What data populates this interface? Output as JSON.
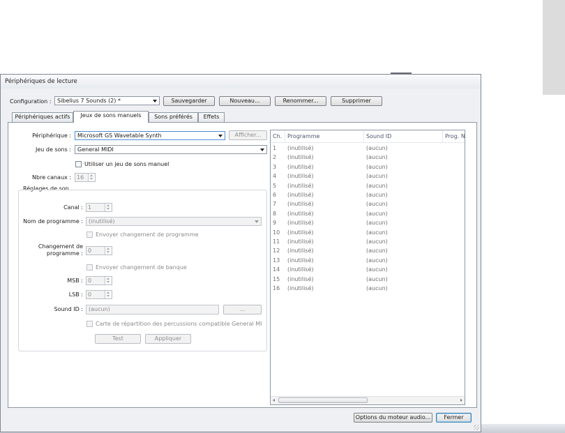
{
  "window": {
    "title": "Périphériques de lecture"
  },
  "config": {
    "label": "Configuration :",
    "value": "Sibelius 7 Sounds (2) *",
    "buttons": {
      "save": "Sauvegarder",
      "new": "Nouveau...",
      "rename": "Renommer...",
      "delete": "Supprimer"
    }
  },
  "tabs": [
    {
      "label": "Périphériques actifs"
    },
    {
      "label": "Jeux de sons manuels",
      "active": true
    },
    {
      "label": "Sons préférés"
    },
    {
      "label": "Effets"
    }
  ],
  "form": {
    "device_label": "Périphérique :",
    "device_value": "Microsoft GS Wavetable Synth",
    "show_button": "Afficher...",
    "soundset_label": "Jeu de sons :",
    "soundset_value": "General MIDI",
    "manual_checkbox": "Utiliser un jeu de sons manuel",
    "channels_label": "Nbre canaux :",
    "channels_value": "16"
  },
  "sound_settings": {
    "title": "Réglages de son",
    "channel_label": "Canal :",
    "channel_value": "1",
    "program_name_label": "Nom de programme :",
    "program_name_value": "(inutilisé)",
    "send_program_change": "Envoyer changement de programme",
    "program_change_label_1": "Changement de",
    "program_change_label_2": "programme :",
    "program_change_value": "0",
    "send_bank_change": "Envoyer changement de banque",
    "msb_label": "MSB :",
    "msb_value": "0",
    "lsb_label": "LSB :",
    "lsb_value": "0",
    "sound_id_label": "Sound ID :",
    "sound_id_value": "(aucun)",
    "browse_button": "...",
    "gm_percussion": "Carte de répartition des percussions compatible General MI",
    "test_button": "Test",
    "apply_button": "Appliquer"
  },
  "list": {
    "headers": {
      "ch": "Ch.",
      "program": "Programme",
      "sound_id": "Sound ID",
      "prog": "Prog. N"
    },
    "rows": [
      {
        "ch": "1",
        "program": "(inutilisé)",
        "sound_id": "(aucun)"
      },
      {
        "ch": "2",
        "program": "(inutilisé)",
        "sound_id": "(aucun)"
      },
      {
        "ch": "3",
        "program": "(inutilisé)",
        "sound_id": "(aucun)"
      },
      {
        "ch": "4",
        "program": "(inutilisé)",
        "sound_id": "(aucun)"
      },
      {
        "ch": "5",
        "program": "(inutilisé)",
        "sound_id": "(aucun)"
      },
      {
        "ch": "6",
        "program": "(inutilisé)",
        "sound_id": "(aucun)"
      },
      {
        "ch": "7",
        "program": "(inutilisé)",
        "sound_id": "(aucun)"
      },
      {
        "ch": "8",
        "program": "(inutilisé)",
        "sound_id": "(aucun)"
      },
      {
        "ch": "9",
        "program": "(inutilisé)",
        "sound_id": "(aucun)"
      },
      {
        "ch": "10",
        "program": "(inutilisé)",
        "sound_id": "(aucun)"
      },
      {
        "ch": "11",
        "program": "(inutilisé)",
        "sound_id": "(aucun)"
      },
      {
        "ch": "12",
        "program": "(inutilisé)",
        "sound_id": "(aucun)"
      },
      {
        "ch": "13",
        "program": "(inutilisé)",
        "sound_id": "(aucun)"
      },
      {
        "ch": "14",
        "program": "(inutilisé)",
        "sound_id": "(aucun)"
      },
      {
        "ch": "15",
        "program": "(inutilisé)",
        "sound_id": "(aucun)"
      },
      {
        "ch": "16",
        "program": "(inutilisé)",
        "sound_id": "(aucun)"
      }
    ]
  },
  "footer": {
    "engine_options": "Options du moteur audio...",
    "close": "Fermer"
  }
}
